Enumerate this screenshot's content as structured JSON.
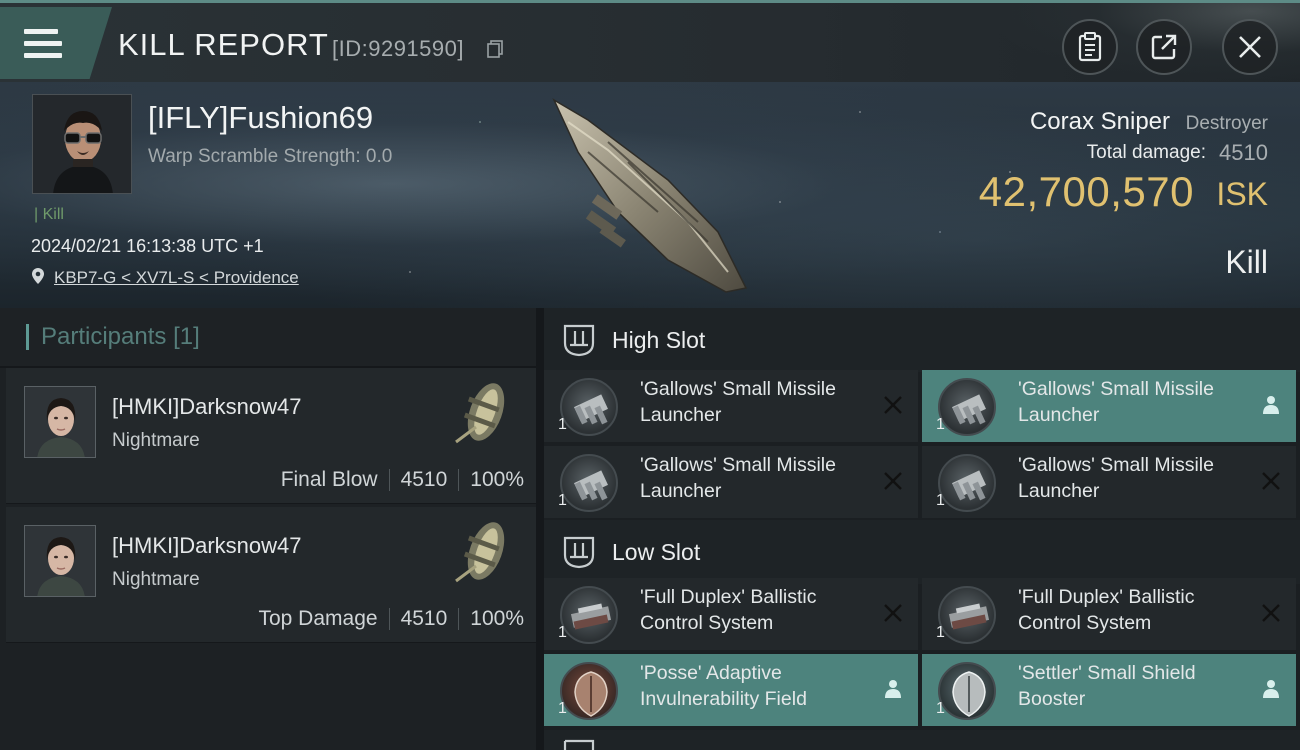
{
  "header": {
    "title": "KILL REPORT",
    "report_id": "[ID:9291590]",
    "buttons": [
      {
        "icon": "clipboard-icon"
      },
      {
        "icon": "share-icon"
      },
      {
        "icon": "close-icon"
      }
    ]
  },
  "victim": {
    "name": "[IFLY]Fushion69",
    "warp_scramble": "Warp Scramble Strength: 0.0",
    "tag": "Kill",
    "datetime": "2024/02/21 16:13:38 UTC +1",
    "location": "KBP7-G < XV7L-S < Providence",
    "ship_name": "Corax Sniper",
    "ship_class": "Destroyer",
    "damage_label": "Total damage:",
    "damage_value": "4510",
    "isk_value": "42,700,570",
    "isk_unit": "ISK",
    "kill_type": "Kill"
  },
  "participants": {
    "label": "Participants",
    "count": "[1]",
    "rows": [
      {
        "name": "[HMKI]Darksnow47",
        "ship": "Nightmare",
        "role": "Final Blow",
        "damage": "4510",
        "percent": "100%"
      },
      {
        "name": "[HMKI]Darksnow47",
        "ship": "Nightmare",
        "role": "Top Damage",
        "damage": "4510",
        "percent": "100%"
      }
    ]
  },
  "fitting": {
    "high_slot": {
      "label": "High Slot",
      "modules": [
        {
          "name": "'Gallows' Small Missile Launcher",
          "qty": "1",
          "status": "destroyed"
        },
        {
          "name": "'Gallows' Small Missile Launcher",
          "qty": "1",
          "status": "dropped"
        },
        {
          "name": "'Gallows' Small Missile Launcher",
          "qty": "1",
          "status": "destroyed"
        },
        {
          "name": "'Gallows' Small Missile Launcher",
          "qty": "1",
          "status": "destroyed"
        }
      ]
    },
    "low_slot": {
      "label": "Low Slot",
      "modules": [
        {
          "name": "'Full Duplex' Ballistic Control System",
          "qty": "1",
          "status": "destroyed"
        },
        {
          "name": "'Full Duplex' Ballistic Control System",
          "qty": "1",
          "status": "destroyed"
        },
        {
          "name": "'Posse' Adaptive Invulnerability Field",
          "qty": "1",
          "status": "dropped"
        },
        {
          "name": "'Settler' Small Shield Booster",
          "qty": "1",
          "status": "dropped"
        }
      ]
    }
  },
  "colors": {
    "accent": "#5e9a94",
    "dropped_bg": "#4d837d",
    "isk_gold": "#e0c170",
    "kill_green": "#6f9a6a"
  }
}
